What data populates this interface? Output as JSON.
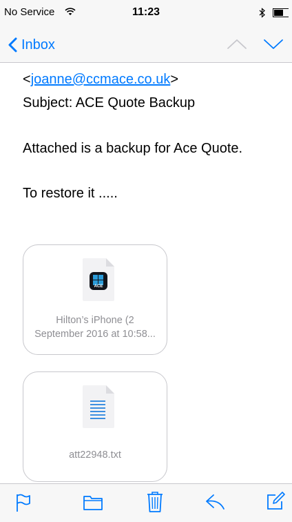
{
  "status_bar": {
    "carrier": "No Service",
    "time": "11:23"
  },
  "nav": {
    "back_label": "Inbox"
  },
  "email": {
    "from_prefix": "<",
    "from_address": "joanne@ccmace.co.uk",
    "from_suffix": ">",
    "subject_line": "Subject: ACE Quote Backup",
    "body_line_1": "Attached is a backup for Ace Quote.",
    "body_line_2": "To restore it ....."
  },
  "attachments": [
    {
      "icon": "ace-app-icon",
      "label_line_1": "Hilton’s iPhone (2",
      "label_line_2": "September 2016 at 10:58..."
    },
    {
      "icon": "text-file-icon",
      "label_line_1": "att22948.txt"
    }
  ],
  "toolbar": {
    "items": [
      "flag-icon",
      "folder-icon",
      "trash-icon",
      "reply-icon",
      "compose-icon"
    ]
  },
  "colors": {
    "accent": "#007aff",
    "secondary_text": "#8e8e93",
    "bar_bg": "#f7f7f7"
  }
}
